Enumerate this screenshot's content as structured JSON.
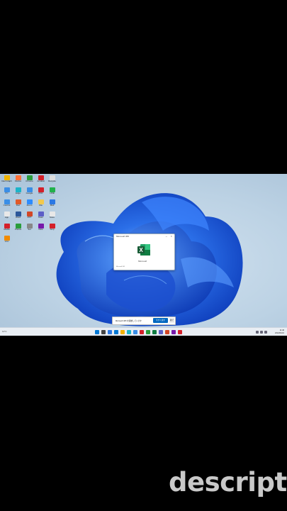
{
  "desktop_icons": [
    {
      "label": "Intel Graphics",
      "color": "#f0b400"
    },
    {
      "label": "Firefox",
      "color": "#ff7139"
    },
    {
      "label": "Chrome",
      "color": "#2a9d3b"
    },
    {
      "label": "Acrobat",
      "color": "#d4202a"
    },
    {
      "label": "Recycle",
      "color": "#dddddd"
    },
    {
      "label": "PC",
      "color": "#3a8ee6"
    },
    {
      "label": "Edge",
      "color": "#1cb4c9"
    },
    {
      "label": "Google",
      "color": "#3a8ee6"
    },
    {
      "label": "PDF",
      "color": "#d4202a"
    },
    {
      "label": "LINE",
      "color": "#22b14c"
    },
    {
      "label": "Control",
      "color": "#3a8ee6"
    },
    {
      "label": "Doc",
      "color": "#e05a2a"
    },
    {
      "label": "Zoom",
      "color": "#2d8cff"
    },
    {
      "label": "File",
      "color": "#f2c94c"
    },
    {
      "label": "Mail",
      "color": "#2b78e4"
    },
    {
      "label": "App",
      "color": "#e8e8e8"
    },
    {
      "label": "Word",
      "color": "#2b579a"
    },
    {
      "label": "PPT",
      "color": "#d24726"
    },
    {
      "label": "Team",
      "color": "#5b5fc7"
    },
    {
      "label": "Store",
      "color": "#e8e8e8"
    },
    {
      "label": "Media",
      "color": "#d4202a"
    },
    {
      "label": "Photos",
      "color": "#2a9d3b"
    },
    {
      "label": "Set",
      "color": "#888888"
    },
    {
      "label": "Note",
      "color": "#7719aa"
    },
    {
      "label": "Snip",
      "color": "#d4202a"
    },
    {
      "label": "VLC",
      "color": "#f08b00"
    }
  ],
  "dialog": {
    "title": "Microsoft 365",
    "close_label": "×",
    "min_label": "–",
    "brand": "Microsoft",
    "footer": "Microsoft 365"
  },
  "notification": {
    "text": "Microsoft 365 を開始しています",
    "primary_label": "今すぐ試す",
    "secondary_label": "後で"
  },
  "taskbar": {
    "weather": "11°C",
    "icons": [
      "#0078d4",
      "#444444",
      "#2b78e4",
      "#0078d4",
      "#f2b100",
      "#1cb4c9",
      "#3a8ee6",
      "#d4202a",
      "#2a9d3b",
      "#107c41",
      "#5b5fc7",
      "#d24726",
      "#7719aa",
      "#d4202a"
    ],
    "time": "11:46",
    "date": "2024/01/16"
  },
  "watermark": "descript",
  "colors": {
    "accent": "#0067c0",
    "excel": "#107c41",
    "bloom": "#1456d6"
  }
}
